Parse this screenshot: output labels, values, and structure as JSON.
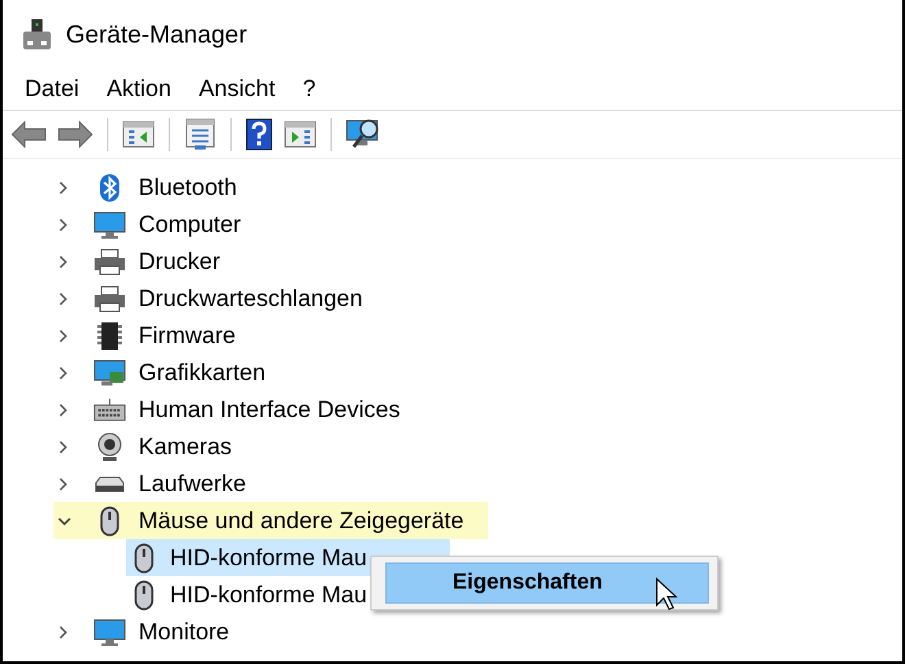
{
  "window": {
    "title": "Geräte-Manager"
  },
  "menu": [
    "Datei",
    "Aktion",
    "Ansicht",
    "?"
  ],
  "tree": [
    {
      "label": "Bluetooth",
      "expanded": false,
      "highlighted": false
    },
    {
      "label": "Computer",
      "expanded": false,
      "highlighted": false
    },
    {
      "label": "Drucker",
      "expanded": false,
      "highlighted": false
    },
    {
      "label": "Druckwarteschlangen",
      "expanded": false,
      "highlighted": false
    },
    {
      "label": "Firmware",
      "expanded": false,
      "highlighted": false
    },
    {
      "label": "Grafikkarten",
      "expanded": false,
      "highlighted": false
    },
    {
      "label": "Human Interface Devices",
      "expanded": false,
      "highlighted": false
    },
    {
      "label": "Kameras",
      "expanded": false,
      "highlighted": false
    },
    {
      "label": "Laufwerke",
      "expanded": false,
      "highlighted": false
    },
    {
      "label": "Mäuse und andere Zeigegeräte",
      "expanded": true,
      "highlighted": true,
      "children": [
        {
          "label": "HID-konforme Mau",
          "selected": true
        },
        {
          "label": "HID-konforme Mau",
          "selected": false
        }
      ]
    },
    {
      "label": "Monitore",
      "expanded": false,
      "highlighted": false
    }
  ],
  "context_menu": [
    {
      "label": "Eigenschaften",
      "selected": true
    }
  ]
}
